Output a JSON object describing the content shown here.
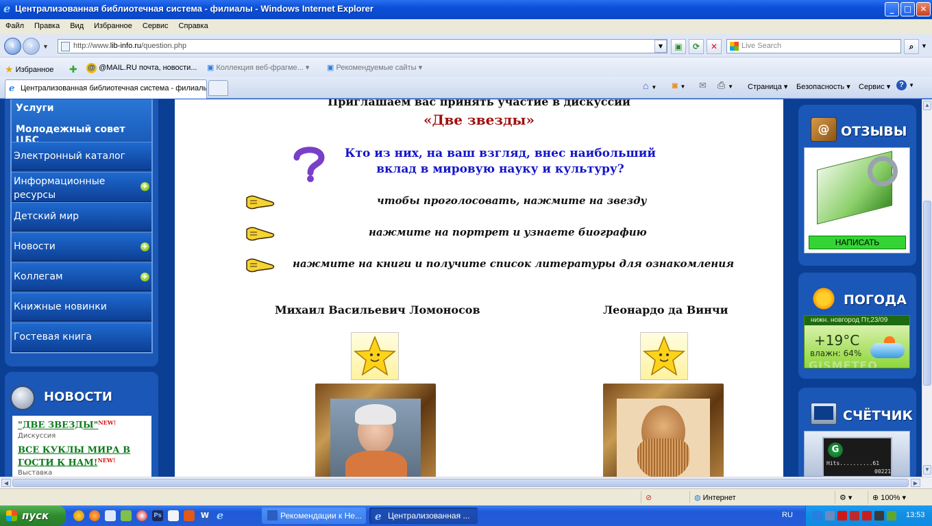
{
  "window": {
    "title": "Централизованная библиотечная система - филиалы - Windows Internet Explorer",
    "buttons": {
      "minimize": "_",
      "maximize": "□",
      "close": "✕"
    }
  },
  "menu": [
    "Файл",
    "Правка",
    "Вид",
    "Избранное",
    "Сервис",
    "Справка"
  ],
  "address": {
    "prefix": "http://www.",
    "host": "lib-info.ru",
    "path": "/question.php",
    "search_placeholder": "Live Search"
  },
  "favorites": {
    "label": "Избранное",
    "items": [
      {
        "label": "@MAIL.RU почта, новости...",
        "muted": false
      },
      {
        "label": "Коллекция веб-фрагме...",
        "muted": true
      },
      {
        "label": "Рекомендуемые сайты",
        "muted": true
      }
    ]
  },
  "tab": {
    "label": "Централизованная библиотечная система - филиалы"
  },
  "toolbar": {
    "page": "Страница",
    "security": "Безопасность",
    "tools": "Сервис"
  },
  "left_menu": {
    "top_items": [
      "Услуги",
      "Молодежный совет ЦБС"
    ],
    "items": [
      {
        "label": "Электронный каталог",
        "expand": false
      },
      {
        "label": "Информационные ресурсы",
        "expand": true
      },
      {
        "label": "Детский мир",
        "expand": false
      },
      {
        "label": "Новости",
        "expand": true
      },
      {
        "label": "Коллегам",
        "expand": true
      },
      {
        "label": "Книжные новинки",
        "expand": false
      },
      {
        "label": "Гостевая книга",
        "expand": false
      }
    ]
  },
  "news": {
    "title": "НОВОСТИ",
    "items": [
      {
        "title": "\"ДВЕ ЗВЕЗДЫ\"",
        "badge": "NEW!",
        "sub": "Дискуссия"
      },
      {
        "title": "ВСЕ КУКЛЫ МИРА В ГОСТИ К НАМ!",
        "badge": "NEW!",
        "sub": "Выставка"
      }
    ]
  },
  "main": {
    "invite": "Приглашаем вас принять участие в дискуссии",
    "topic": "«Две звезды»",
    "question": "Кто из них, на ваш взгляд, внес наибольший вклад в мировую науку и культуру?",
    "instructions": [
      "чтобы проголосовать, нажмите на звезду",
      "нажмите на портрет и узнаете биографию",
      "нажмите на книги и получите список литературы для ознакомления"
    ],
    "candidates": [
      {
        "name": "Михаил Васильевич Ломоносов"
      },
      {
        "name": "Леонардо да Винчи"
      }
    ]
  },
  "right": {
    "reviews_title": "ОТЗЫВЫ",
    "write_button": "НАПИСАТЬ",
    "weather_title": "ПОГОДА",
    "weather": {
      "city": "нижн. новгород",
      "date": "Пт,23/09",
      "temp": "+19°C",
      "humidity": "влажн: 64%",
      "brand": "GISMETEO"
    },
    "counter_title": "СЧЁТЧИК",
    "counter": {
      "hits": "Hits..........61",
      "sub": "00221"
    }
  },
  "status": {
    "zone": "Интернет",
    "zoom": "100%"
  },
  "taskbar": {
    "start": "пуск",
    "tasks": [
      "Рекомендации к Не...",
      "Централизованная ..."
    ],
    "lang": "RU",
    "time": "13:53"
  },
  "colors": {
    "topic": "#a01010",
    "question": "#1515c8",
    "news_link": "#0d7a1c",
    "accent_blue": "#1a57b6"
  }
}
